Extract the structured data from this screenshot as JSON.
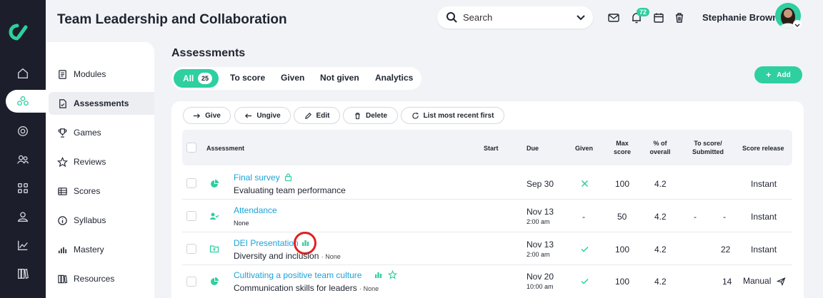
{
  "header": {
    "title": "Team Leadership and Collaboration",
    "search_placeholder": "Search",
    "notification_count": "72",
    "user_name": "Stephanie Brown"
  },
  "rail": {
    "icons": [
      "home-icon",
      "nodes-icon",
      "target-icon",
      "people-icon",
      "grid-icon",
      "user-icon",
      "chart-icon",
      "books-icon"
    ]
  },
  "sidenav": {
    "items": [
      {
        "label": "Modules",
        "icon": "document-icon"
      },
      {
        "label": "Assessments",
        "icon": "file-check-icon",
        "active": true
      },
      {
        "label": "Games",
        "icon": "trophy-icon"
      },
      {
        "label": "Reviews",
        "icon": "star-icon"
      },
      {
        "label": "Scores",
        "icon": "table-icon"
      },
      {
        "label": "Syllabus",
        "icon": "info-icon"
      },
      {
        "label": "Mastery",
        "icon": "bars-icon"
      },
      {
        "label": "Resources",
        "icon": "books-icon"
      }
    ]
  },
  "main": {
    "title": "Assessments",
    "tabs": [
      {
        "label": "All",
        "count": "25",
        "active": true
      },
      {
        "label": "To score"
      },
      {
        "label": "Given"
      },
      {
        "label": "Not given"
      },
      {
        "label": "Analytics"
      }
    ],
    "add_label": "Add",
    "toolbar": {
      "give": "Give",
      "ungive": "Ungive",
      "edit": "Edit",
      "delete": "Delete",
      "sort": "List most recent first"
    },
    "columns": {
      "assessment": "Assessment",
      "start": "Start",
      "due": "Due",
      "given": "Given",
      "max_score_1": "Max",
      "max_score_2": "score",
      "pct_1": "% of",
      "pct_2": "overall",
      "toscore_1": "To score/",
      "toscore_2": "Submitted",
      "release": "Score release"
    },
    "rows": [
      {
        "name": "Final survey",
        "sub": "Evaluating team performance",
        "sub_note": "",
        "due": "Sep 30",
        "due_time": "",
        "given": "x",
        "max": "100",
        "pct": "4.2",
        "to_score": "",
        "submitted": "",
        "release": "Instant"
      },
      {
        "name": "Attendance",
        "sub": "",
        "sub_note": "None",
        "due": "Nov 13",
        "due_time": "2:00 am",
        "given": "-",
        "max": "50",
        "pct": "4.2",
        "to_score": "-",
        "submitted": "-",
        "release": "Instant"
      },
      {
        "name": "DEI Presentation",
        "sub": "Diversity and inclusion",
        "sub_note": "· None",
        "due": "Nov 13",
        "due_time": "2:00 am",
        "given": "check",
        "max": "100",
        "pct": "4.2",
        "to_score": "",
        "submitted": "22",
        "release": "Instant"
      },
      {
        "name": "Cultivating a positive team culture",
        "sub": "Communication skills for leaders",
        "sub_note": "· None",
        "due": "Nov 20",
        "due_time": "10:00 am",
        "given": "check",
        "max": "100",
        "pct": "4.2",
        "to_score": "",
        "submitted": "14",
        "release": "Manual"
      }
    ]
  },
  "colors": {
    "accent": "#2ecfa0",
    "link": "#1aa3d9",
    "rail": "#1c1f2b",
    "highlight_ring": "#e02020"
  }
}
